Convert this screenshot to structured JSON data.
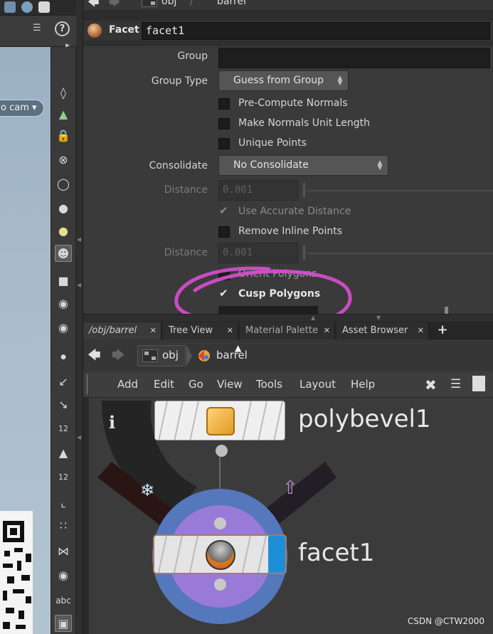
{
  "param_pane": {
    "path": [
      "obj",
      "barrel"
    ],
    "node_type": "Facet",
    "node_name": "facet1",
    "params": {
      "group_label": "Group",
      "group_value": "",
      "group_type_label": "Group Type",
      "group_type_value": "Guess from Group",
      "precompute_normals_label": "Pre-Compute Normals",
      "make_unit_length_label": "Make Normals Unit Length",
      "unique_points_label": "Unique Points",
      "consolidate_label": "Consolidate",
      "consolidate_value": "No Consolidate",
      "distance_label": "Distance",
      "distance_value": "0.001",
      "use_accurate_distance_label": "Use Accurate Distance",
      "remove_inline_label": "Remove Inline Points",
      "distance2_label": "Distance",
      "distance2_value": "0.001",
      "orient_polygons_label": "Orient Polygons",
      "cusp_polygons_label": "Cusp Polygons"
    },
    "checks": {
      "precompute_normals": false,
      "make_unit_length": false,
      "unique_points": false,
      "use_accurate_distance": true,
      "remove_inline": false,
      "orient_polygons": false,
      "cusp_polygons": true
    }
  },
  "viewport": {
    "camera_label": "o cam"
  },
  "tabs": [
    {
      "label": "/obj/barrel",
      "active": true
    },
    {
      "label": "Tree View",
      "active": false
    },
    {
      "label": "Material Palette",
      "active": false
    },
    {
      "label": "Asset Browser",
      "active": false
    }
  ],
  "network": {
    "path": [
      "obj",
      "barrel"
    ],
    "menu": [
      "Add",
      "Edit",
      "Go",
      "View",
      "Tools",
      "Layout",
      "Help"
    ],
    "nodes": [
      {
        "name": "polybevel1"
      },
      {
        "name": "facet1"
      }
    ],
    "info_glyph": "i",
    "shelf_text_icon": "abc",
    "shelf_num_label": "12"
  },
  "colors": {
    "annotation": "#d94fd0",
    "display_flag": "#1e8fd6",
    "ring_dark": "#242424",
    "ring_blue": "#5577bb",
    "ring_purple": "#9a7ad8"
  },
  "watermark": "CSDN @CTW2000"
}
